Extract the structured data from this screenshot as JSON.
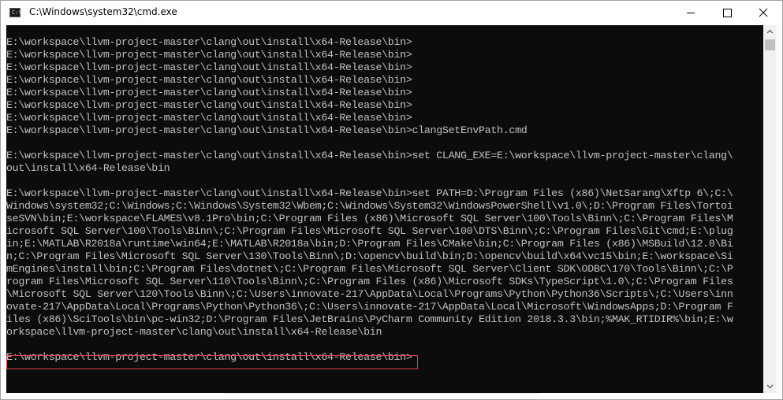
{
  "window": {
    "title": "C:\\Windows\\system32\\cmd.exe",
    "app_icon": "cmd-icon",
    "controls": {
      "minimize": "minimize-icon",
      "maximize": "maximize-icon",
      "close": "close-icon"
    }
  },
  "console": {
    "lines": [
      "E:\\workspace\\llvm-project-master\\clang\\out\\install\\x64-Release\\bin>",
      "E:\\workspace\\llvm-project-master\\clang\\out\\install\\x64-Release\\bin>",
      "E:\\workspace\\llvm-project-master\\clang\\out\\install\\x64-Release\\bin>",
      "E:\\workspace\\llvm-project-master\\clang\\out\\install\\x64-Release\\bin>",
      "E:\\workspace\\llvm-project-master\\clang\\out\\install\\x64-Release\\bin>",
      "E:\\workspace\\llvm-project-master\\clang\\out\\install\\x64-Release\\bin>",
      "E:\\workspace\\llvm-project-master\\clang\\out\\install\\x64-Release\\bin>",
      "E:\\workspace\\llvm-project-master\\clang\\out\\install\\x64-Release\\bin>clangSetEnvPath.cmd",
      "",
      "E:\\workspace\\llvm-project-master\\clang\\out\\install\\x64-Release\\bin>set CLANG_EXE=E:\\workspace\\llvm-project-master\\clang\\",
      "out\\install\\x64-Release\\bin",
      "",
      "E:\\workspace\\llvm-project-master\\clang\\out\\install\\x64-Release\\bin>set PATH=D:\\Program Files (x86)\\NetSarang\\Xftp 6\\;C:\\",
      "Windows\\system32;C:\\Windows;C:\\Windows\\System32\\Wbem;C:\\Windows\\System32\\WindowsPowerShell\\v1.0\\;D:\\Program Files\\Tortoi",
      "seSVN\\bin;E:\\workspace\\FLAMES\\v8.1Pro\\bin;C:\\Program Files (x86)\\Microsoft SQL Server\\100\\Tools\\Binn\\;C:\\Program Files\\M",
      "icrosoft SQL Server\\100\\Tools\\Binn\\;C:\\Program Files\\Microsoft SQL Server\\100\\DTS\\Binn\\;C:\\Program Files\\Git\\cmd;E:\\plug",
      "in;E:\\MATLAB\\R2018a\\runtime\\win64;E:\\MATLAB\\R2018a\\bin;D:\\Program Files\\CMake\\bin;C:\\Program Files (x86)\\MSBuild\\12.0\\Bi",
      "n;C:\\Program Files\\Microsoft SQL Server\\130\\Tools\\Binn\\;D:\\opencv\\build\\bin;D:\\opencv\\build\\x64\\vc15\\bin;E:\\workspace\\Si",
      "mEngines\\install\\bin;C:\\Program Files\\dotnet\\;C:\\Program Files\\Microsoft SQL Server\\Client SDK\\ODBC\\170\\Tools\\Binn\\;C:\\P",
      "rogram Files\\Microsoft SQL Server\\110\\Tools\\Binn\\;C:\\Program Files (x86)\\Microsoft SDKs\\TypeScript\\1.0\\;C:\\Program Files",
      "\\Microsoft SQL Server\\120\\Tools\\Binn\\;C:\\Users\\innovate-217\\AppData\\Local\\Programs\\Python\\Python36\\Scripts\\;C:\\Users\\inn",
      "ovate-217\\AppData\\Local\\Programs\\Python\\Python36\\;C:\\Users\\innovate-217\\AppData\\Local\\Microsoft\\WindowsApps;D:\\Program F",
      "iles (x86)\\SciTools\\bin\\pc-win32;D:\\Program Files\\JetBrains\\PyCharm Community Edition 2018.3.3\\bin;%MAK_RTIDIR%\\bin;E:\\w",
      "orkspace\\llvm-project-master\\clang\\out\\install\\x64-Release\\bin",
      "",
      "E:\\workspace\\llvm-project-master\\clang\\out\\install\\x64-Release\\bin>"
    ]
  },
  "scrollbar": {
    "up_arrow": "chevron-up-icon",
    "down_arrow": "chevron-down-icon"
  }
}
